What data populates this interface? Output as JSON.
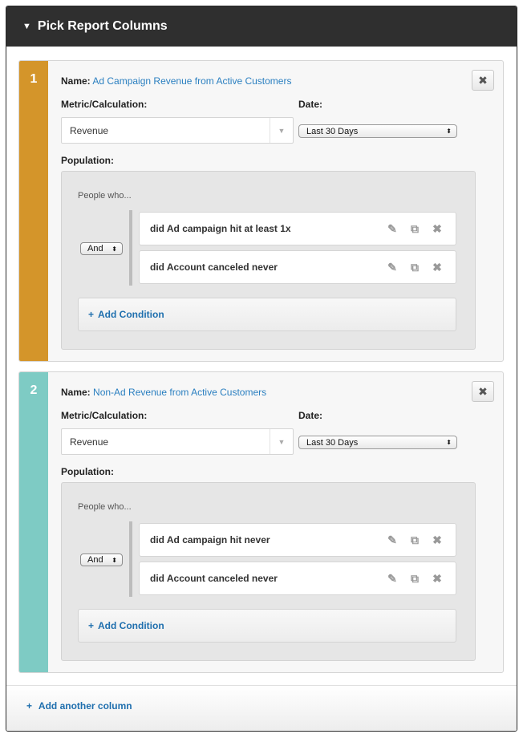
{
  "header": {
    "title": "Pick Report Columns",
    "toggle_icon": "▼"
  },
  "columns": [
    {
      "number": "1",
      "name_label": "Name:",
      "name_value": "Ad Campaign Revenue from Active Customers",
      "metric_label": "Metric/Calculation:",
      "metric_value": "Revenue",
      "date_label": "Date:",
      "date_value": "Last 30 Days",
      "population_label": "Population:",
      "people_who": "People who...",
      "logic": "And",
      "conditions": [
        "did Ad campaign hit at least 1x",
        "did Account canceled never"
      ],
      "add_condition": "Add Condition",
      "accent": "#d4952a"
    },
    {
      "number": "2",
      "name_label": "Name:",
      "name_value": "Non-Ad Revenue from Active Customers",
      "metric_label": "Metric/Calculation:",
      "metric_value": "Revenue",
      "date_label": "Date:",
      "date_value": "Last 30 Days",
      "population_label": "Population:",
      "people_who": "People who...",
      "logic": "And",
      "conditions": [
        "did Ad campaign hit never",
        "did Account canceled never"
      ],
      "add_condition": "Add Condition",
      "accent": "#7ecbc4"
    }
  ],
  "footer": {
    "add_column": "Add another column"
  },
  "icons": {
    "close": "close-icon",
    "edit": "edit-icon",
    "copy": "copy-icon",
    "delete": "delete-icon",
    "plus": "plus-icon"
  }
}
